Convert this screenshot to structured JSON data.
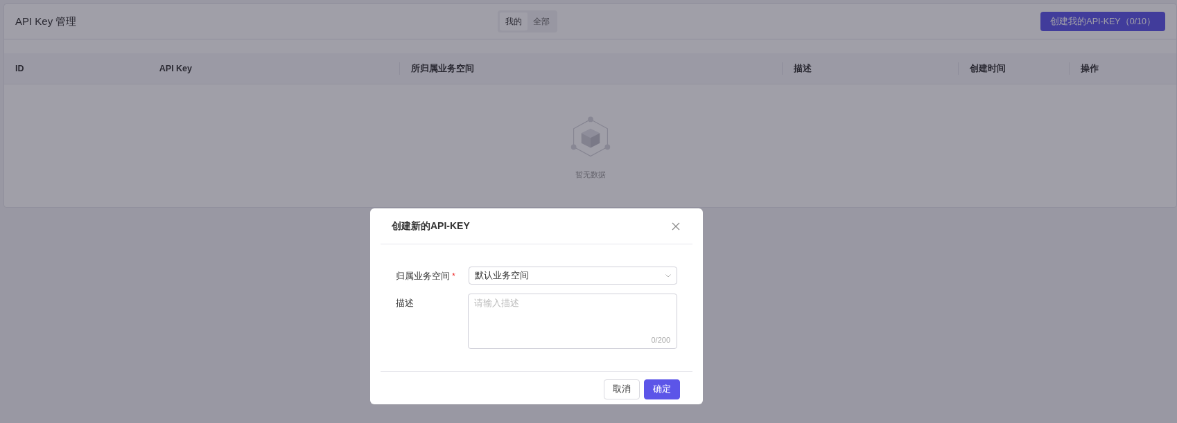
{
  "page": {
    "title": "API Key 管理"
  },
  "scope_tabs": [
    {
      "label": "我的",
      "selected": true
    },
    {
      "label": "全部",
      "selected": false
    }
  ],
  "create_button": "创建我的API-KEY（0/10）",
  "table": {
    "columns": [
      "ID",
      "API Key",
      "所归属业务空间",
      "描述",
      "创建时间",
      "操作"
    ],
    "empty_text": "暂无数据"
  },
  "dialog": {
    "title": "创建新的API-KEY",
    "fields": [
      {
        "kind": "select",
        "label": "归属业务空间",
        "required_mark": "*",
        "value": "默认业务空间"
      },
      {
        "kind": "textarea",
        "label": "描述",
        "placeholder": "请输入描述",
        "counter": "0/200"
      }
    ],
    "buttons": [
      {
        "label": "取消",
        "primary": false
      },
      {
        "label": "确定",
        "primary": true
      }
    ]
  }
}
